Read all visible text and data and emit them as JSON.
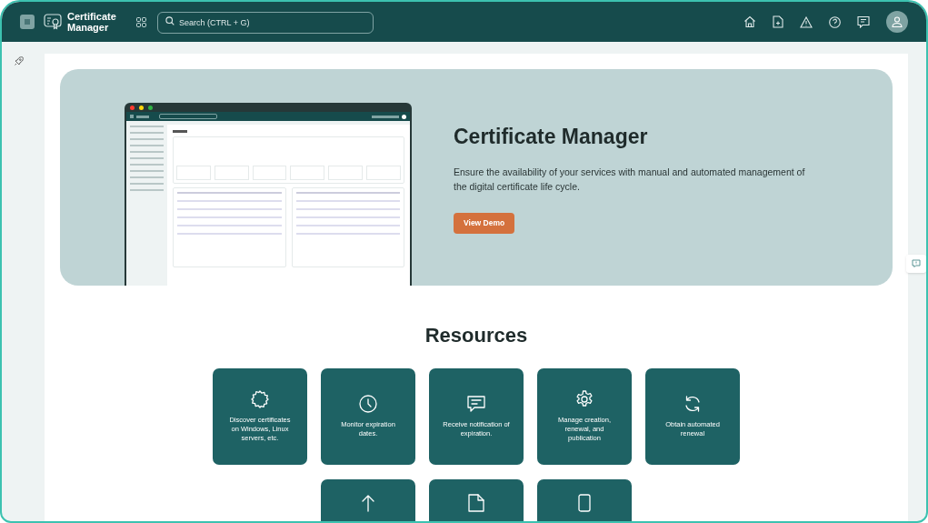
{
  "header": {
    "app_title": "Certificate Manager",
    "search": {
      "placeholder": "Search (CTRL + G)"
    }
  },
  "hero": {
    "title": "Certificate Manager",
    "description": "Ensure the availability of your services with manual and automated management of the digital certificate life cycle.",
    "button": "View Demo"
  },
  "resources": {
    "title": "Resources",
    "cards": [
      {
        "text": "Discover certificates on Windows, Linux servers, etc.",
        "cut_off": false
      },
      {
        "text": "Monitor expiration dates.",
        "cut_off": false
      },
      {
        "text": "Receive notification of expiration.",
        "cut_off": false
      },
      {
        "text": "Manage creation, renewal, and publication",
        "cut_off": false
      },
      {
        "text": "Obtain automated renewal",
        "cut_off": false
      },
      {
        "cut_off": true
      },
      {
        "cut_off": true
      },
      {
        "cut_off": true
      }
    ]
  }
}
